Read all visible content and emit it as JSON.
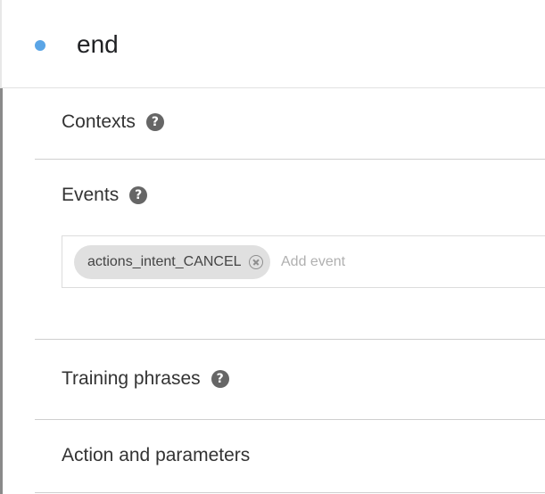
{
  "intent": {
    "name": "end",
    "status_color": "#5aa5e6"
  },
  "sections": {
    "contexts": {
      "title": "Contexts",
      "help_icon": "help-circle-icon"
    },
    "events": {
      "title": "Events",
      "help_icon": "help-circle-icon",
      "chips": [
        "actions_intent_CANCEL"
      ],
      "input_placeholder": "Add event",
      "input_value": ""
    },
    "training_phrases": {
      "title": "Training phrases",
      "help_icon": "help-circle-icon"
    },
    "action_parameters": {
      "title": "Action and parameters"
    }
  }
}
